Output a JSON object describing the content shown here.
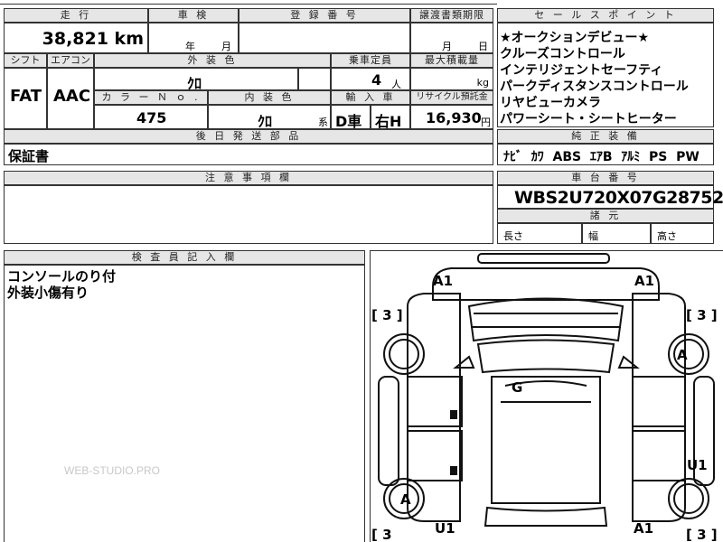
{
  "header": {
    "mileage_label": "走 行",
    "mileage_value": "38,821 km",
    "inspection_label": "車 検",
    "inspection_year": "年",
    "inspection_month": "月",
    "registration_label": "登 録 番 号",
    "transfer_label": "譲渡書類期限",
    "transfer_month": "月",
    "transfer_day": "日"
  },
  "row2": {
    "shift_label": "シフト",
    "shift_value": "FAT",
    "ac_label": "エアコン",
    "ac_value": "AAC",
    "ext_color_label": "外 装 色",
    "ext_color_value": "ｸﾛ",
    "capacity_label": "乗車定員",
    "capacity_value": "4",
    "capacity_unit": "人",
    "load_label": "最大積載量",
    "load_unit": "kg",
    "color_no_label": "カ ラ ー Ｎ ｏ .",
    "color_no_value": "475",
    "int_color_label": "内 装 色",
    "int_color_value": "ｸﾛ",
    "int_color_suffix": "系",
    "import_label": "輸 入 車",
    "import_value_1": "D車",
    "import_value_2": "右H",
    "recycle_label": "リサイクル預託金",
    "recycle_value": "16,930",
    "recycle_unit": "円"
  },
  "after_parts": {
    "label": "後 日 発 送 部 品",
    "value": "保証書"
  },
  "notes": {
    "label": "注 意 事 項 欄"
  },
  "sales_points": {
    "label": "セ ー ル ス ポ イ ン ト",
    "items": [
      "★オークションデビュー★",
      "クルーズコントロール",
      "インテリジェントセーフティ",
      "パークディスタンスコントロール",
      "リヤビューカメラ",
      "パワーシート・シートヒーター"
    ]
  },
  "equipment": {
    "label": "純 正 装 備",
    "value": "ﾅﾋﾞ  ｶﾜ  ABS  ｴｱB  ｱﾙﾐ  PS  PW"
  },
  "chassis": {
    "label": "車 台 番 号",
    "value": "WBS2U720X07G28752"
  },
  "dimensions": {
    "label": "諸 元",
    "length": "長さ",
    "width": "幅",
    "height": "高さ"
  },
  "inspector": {
    "label": "検 査 員 記 入 欄",
    "line1": "コンソールのり付",
    "line2": "外装小傷有り"
  },
  "watermark": "WEB-STUDIO.PRO",
  "diagram": {
    "marks": {
      "a1_top_left": "A1",
      "a1_top_right": "A1",
      "a_right_wheel": "A",
      "g_roof": "G",
      "u1_right": "U1",
      "a_left_wheel": "A",
      "u1_bottom": "U1",
      "a1_bottom_right": "A1"
    },
    "tire_left_top": "[ 3 ]",
    "tire_right_top": "[ 3 ]",
    "tire_left_bottom": "[ 3",
    "tire_right_bottom": "[ 3 ]"
  }
}
